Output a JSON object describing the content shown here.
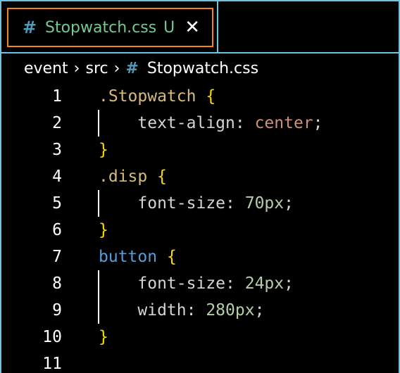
{
  "tab": {
    "icon": "css-hash-icon",
    "hash": "#",
    "title": "Stopwatch.css",
    "status": "U",
    "close": "✕"
  },
  "breadcrumb": {
    "items": [
      "event",
      "src"
    ],
    "file_hash": "#",
    "file": "Stopwatch.css",
    "separator": "›"
  },
  "editor": {
    "lines": [
      {
        "n": "1",
        "parts": [
          [
            ".Stopwatch ",
            "sel"
          ],
          [
            "{",
            "brace"
          ]
        ]
      },
      {
        "n": "2",
        "parts": [
          [
            "    text-align",
            "plain"
          ],
          [
            ": ",
            "plain"
          ],
          [
            "center",
            "val"
          ],
          [
            ";",
            "plain"
          ]
        ],
        "guide": true
      },
      {
        "n": "3",
        "parts": [
          [
            "}",
            "brace"
          ]
        ]
      },
      {
        "n": "4",
        "parts": [
          [
            ".disp ",
            "sel"
          ],
          [
            "{",
            "brace"
          ]
        ]
      },
      {
        "n": "5",
        "parts": [
          [
            "    font-size",
            "plain"
          ],
          [
            ": ",
            "plain"
          ],
          [
            "70px",
            "num"
          ],
          [
            ";",
            "plain"
          ]
        ],
        "guide": true
      },
      {
        "n": "6",
        "parts": [
          [
            "}",
            "brace"
          ]
        ]
      },
      {
        "n": "7",
        "parts": [
          [
            "button ",
            "tag"
          ],
          [
            "{",
            "brace"
          ]
        ]
      },
      {
        "n": "8",
        "parts": [
          [
            "    font-size",
            "plain"
          ],
          [
            ": ",
            "plain"
          ],
          [
            "24px",
            "num"
          ],
          [
            ";",
            "plain"
          ]
        ],
        "guide": true
      },
      {
        "n": "9",
        "parts": [
          [
            "    width",
            "plain"
          ],
          [
            ": ",
            "plain"
          ],
          [
            "280px",
            "num"
          ],
          [
            ";",
            "plain"
          ]
        ],
        "guide": true
      },
      {
        "n": "10",
        "parts": [
          [
            "}",
            "brace"
          ]
        ]
      },
      {
        "n": "11",
        "parts": []
      }
    ]
  },
  "colors": {
    "border": "#6fc3df",
    "active_tab_border": "#f38518",
    "file_status": "#73c991",
    "css_icon": "#519aba"
  }
}
